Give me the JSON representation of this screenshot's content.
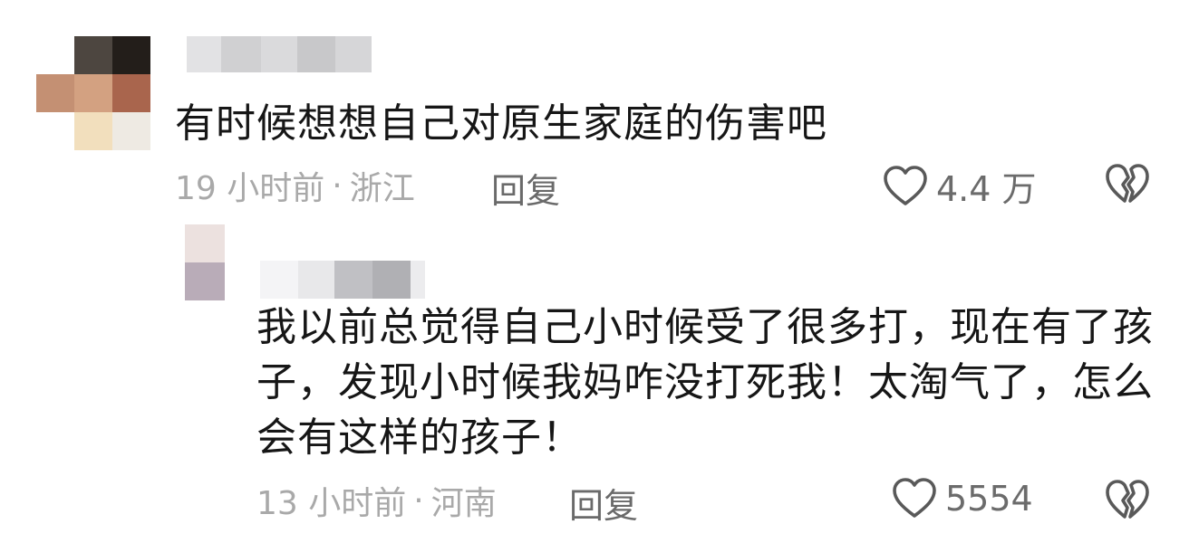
{
  "comments": {
    "main": {
      "text": "有时候想想自己对原生家庭的伤害吧",
      "time": "19 小时前",
      "separator": "·",
      "location": "浙江",
      "reply_label": "回复",
      "like_count": "4.4 万"
    },
    "reply": {
      "text": "我以前总觉得自己小时候受了很多打，现在有了孩子，发现小时候我妈咋没打死我！太淘气了，怎么会有这样的孩子！",
      "time": "13 小时前",
      "separator": "·",
      "location": "河南",
      "reply_label": "回复",
      "like_count": "5554"
    }
  },
  "colors": {
    "text_primary": "#161616",
    "text_meta": "#a9a9a9",
    "text_action": "#6a6a6a",
    "icon_stroke": "#595959",
    "avatar_main_pixels": [
      "#ffffff",
      "#4d4640",
      "#231e1a",
      "#c49073",
      "#d3a181",
      "#a9654d",
      "#ffffff",
      "#f2dfbd",
      "#eeeae3"
    ],
    "avatar_reply_pixels": [
      "#ece1df",
      "#b9acb8"
    ],
    "name_main_pixels": [
      "#e2e2e4",
      "#d0d0d2",
      "#dadadc",
      "#c8c8ca",
      "#d6d6d8"
    ],
    "name_reply_pixels": [
      "#f4f4f6",
      "#e8e8ea",
      "#c0c0c4",
      "#b0b0b4",
      "#ececee"
    ]
  }
}
